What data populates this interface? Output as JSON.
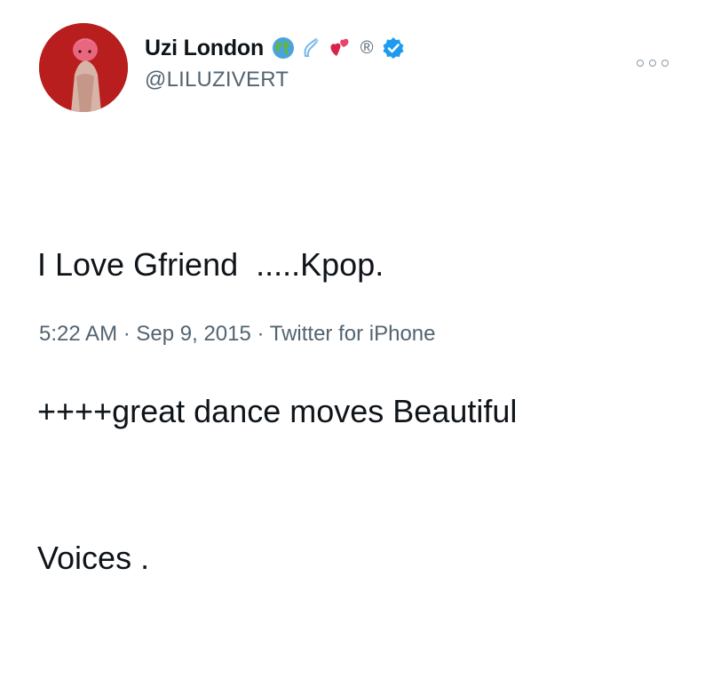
{
  "tweet": {
    "display_name": "Uzi London",
    "name_emojis": [
      "globe-icon",
      "ring-icon",
      "hearts-icon",
      "registered-icon",
      "verified-badge-icon"
    ],
    "registered_mark": "®",
    "handle": "@LILUZIVERT",
    "text_lines": [
      "I Love Gfriend  .....Kpop.",
      "++++great dance moves Beautiful",
      "Voices ."
    ],
    "time": "5:22 AM",
    "separator": " · ",
    "date": "Sep 9, 2015",
    "source": "Twitter for iPhone"
  },
  "colors": {
    "name": "#0f1419",
    "secondary": "#536471",
    "verified": "#1d9bf0",
    "avatar": "#b81e1e"
  }
}
